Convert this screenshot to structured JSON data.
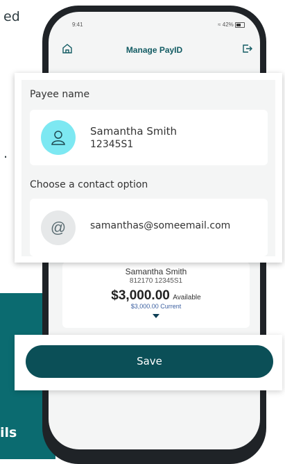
{
  "background": {
    "frag_top": "ed",
    "frag_mid": ".",
    "frag_bottom": "ils"
  },
  "status_bar": {
    "time": "9:41",
    "battery": "42%"
  },
  "app_bar": {
    "title": "Manage PayID",
    "left_icon": "home-icon",
    "right_icon": "logout-icon"
  },
  "account_card": {
    "name": "Samantha Smith",
    "number": "812170  12345S1",
    "balance": "$3,000.00",
    "balance_label": "Available",
    "current": "$3,000.00 Current"
  },
  "popup": {
    "payee_label": "Payee name",
    "payee_name": "Samantha Smith",
    "payee_id": "12345S1",
    "contact_label": "Choose a contact option",
    "contact_email": "samanthas@someemail.com"
  },
  "save": {
    "label": "Save"
  },
  "colors": {
    "brand": "#0b4f57",
    "title": "#125b63",
    "avatar": "#7de8f2"
  }
}
